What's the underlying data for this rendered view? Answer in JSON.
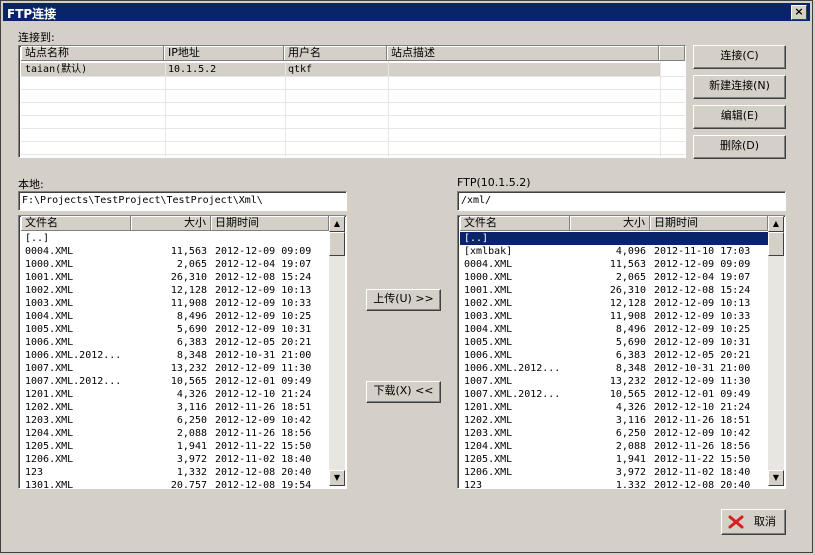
{
  "window": {
    "title": "FTP连接",
    "close_glyph": "×"
  },
  "sites": {
    "label": "连接到:",
    "headers": [
      "站点名称",
      "IP地址",
      "用户名",
      "站点描述"
    ],
    "rows": [
      {
        "name": "taian(默认)",
        "ip": "10.1.5.2",
        "user": "qtkf",
        "desc": ""
      }
    ]
  },
  "site_buttons": {
    "connect": "连接(C)",
    "new": "新建连接(N)",
    "edit": "编辑(E)",
    "delete": "删除(D)"
  },
  "local": {
    "label": "本地:",
    "path": "F:\\Projects\\TestProject\\TestProject\\Xml\\",
    "headers": [
      "文件名",
      "大小",
      "日期时间"
    ],
    "rows": [
      [
        "[..]",
        "",
        ""
      ],
      [
        "0004.XML",
        "11,563",
        "2012-12-09 09:09"
      ],
      [
        "1000.XML",
        "2,065",
        "2012-12-04 19:07"
      ],
      [
        "1001.XML",
        "26,310",
        "2012-12-08 15:24"
      ],
      [
        "1002.XML",
        "12,128",
        "2012-12-09 10:13"
      ],
      [
        "1003.XML",
        "11,908",
        "2012-12-09 10:33"
      ],
      [
        "1004.XML",
        "8,496",
        "2012-12-09 10:25"
      ],
      [
        "1005.XML",
        "5,690",
        "2012-12-09 10:31"
      ],
      [
        "1006.XML",
        "6,383",
        "2012-12-05 20:21"
      ],
      [
        "1006.XML.2012...",
        "8,348",
        "2012-10-31 21:00"
      ],
      [
        "1007.XML",
        "13,232",
        "2012-12-09 11:30"
      ],
      [
        "1007.XML.2012...",
        "10,565",
        "2012-12-01 09:49"
      ],
      [
        "1201.XML",
        "4,326",
        "2012-12-10 21:24"
      ],
      [
        "1202.XML",
        "3,116",
        "2012-11-26 18:51"
      ],
      [
        "1203.XML",
        "6,250",
        "2012-12-09 10:42"
      ],
      [
        "1204.XML",
        "2,088",
        "2012-11-26 18:56"
      ],
      [
        "1205.XML",
        "1,941",
        "2012-11-22 15:50"
      ],
      [
        "1206.XML",
        "3,972",
        "2012-11-02 18:40"
      ],
      [
        "123",
        "1,332",
        "2012-12-08 20:40"
      ],
      [
        "1301.XML",
        "20,757",
        "2012-12-08 19:54"
      ]
    ]
  },
  "ftp": {
    "label": "FTP(10.1.5.2)",
    "path": "/xml/",
    "headers": [
      "文件名",
      "大小",
      "日期时间"
    ],
    "rows": [
      [
        "[..]",
        "",
        ""
      ],
      [
        "[xmlbak]",
        "4,096",
        "2012-11-10 17:03"
      ],
      [
        "0004.XML",
        "11,563",
        "2012-12-09 09:09"
      ],
      [
        "1000.XML",
        "2,065",
        "2012-12-04 19:07"
      ],
      [
        "1001.XML",
        "26,310",
        "2012-12-08 15:24"
      ],
      [
        "1002.XML",
        "12,128",
        "2012-12-09 10:13"
      ],
      [
        "1003.XML",
        "11,908",
        "2012-12-09 10:33"
      ],
      [
        "1004.XML",
        "8,496",
        "2012-12-09 10:25"
      ],
      [
        "1005.XML",
        "5,690",
        "2012-12-09 10:31"
      ],
      [
        "1006.XML",
        "6,383",
        "2012-12-05 20:21"
      ],
      [
        "1006.XML.2012...",
        "8,348",
        "2012-10-31 21:00"
      ],
      [
        "1007.XML",
        "13,232",
        "2012-12-09 11:30"
      ],
      [
        "1007.XML.2012...",
        "10,565",
        "2012-12-01 09:49"
      ],
      [
        "1201.XML",
        "4,326",
        "2012-12-10 21:24"
      ],
      [
        "1202.XML",
        "3,116",
        "2012-11-26 18:51"
      ],
      [
        "1203.XML",
        "6,250",
        "2012-12-09 10:42"
      ],
      [
        "1204.XML",
        "2,088",
        "2012-11-26 18:56"
      ],
      [
        "1205.XML",
        "1,941",
        "2012-11-22 15:50"
      ],
      [
        "1206.XML",
        "3,972",
        "2012-11-02 18:40"
      ],
      [
        "123",
        "1,332",
        "2012-12-08 20:40"
      ]
    ],
    "selected_index": 0
  },
  "transfer": {
    "upload": "上传(U) >>",
    "download": "下载(X) <<"
  },
  "cancel": {
    "label": "取消",
    "icon": "cancel-x-icon",
    "icon_color": "#d42020"
  },
  "colors": {
    "title_bar": "#0a246a",
    "selection": "#0a246a"
  }
}
